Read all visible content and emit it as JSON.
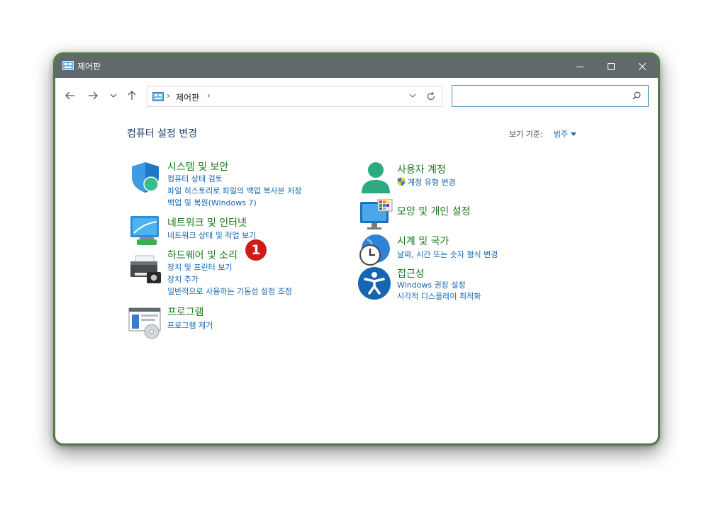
{
  "window": {
    "title": "제어판"
  },
  "address": {
    "crumb": "제어판",
    "separator": "›"
  },
  "search": {
    "placeholder": ""
  },
  "page": {
    "title": "컴퓨터 설정 변경"
  },
  "view_by": {
    "label": "보기 기준:",
    "value": "범주"
  },
  "left_categories": [
    {
      "title": "시스템 및 보안",
      "icon": "shield-icon",
      "links": [
        "컴퓨터 상태 검토",
        "파일 히스토리로 파일의 백업 복사본 저장",
        "백업 및 복원(Windows 7)"
      ]
    },
    {
      "title": "네트워크 및 인터넷",
      "icon": "network-icon",
      "links": [
        "네트워크 상태 및 작업 보기"
      ]
    },
    {
      "title": "하드웨어 및 소리",
      "icon": "printer-icon",
      "links": [
        "장치 및 프린터 보기",
        "장치 추가",
        "일반적으로 사용하는 기동성 설정 조정"
      ]
    },
    {
      "title": "프로그램",
      "icon": "programs-icon",
      "links": [
        "프로그램 제거"
      ]
    }
  ],
  "right_categories": [
    {
      "title": "사용자 계정",
      "icon": "user-icon",
      "links": [
        "계정 유형 변경"
      ]
    },
    {
      "title": "모양 및 개인 설정",
      "icon": "monitor-icon",
      "links": []
    },
    {
      "title": "시계 및 국가",
      "icon": "clock-globe-icon",
      "links": [
        "날짜, 시간 또는 숫자 형식 변경"
      ]
    },
    {
      "title": "접근성",
      "icon": "accessibility-icon",
      "links": [
        "Windows 권장 설정",
        "시각적 디스플레이 최적화"
      ]
    }
  ],
  "badge": {
    "number": "1"
  },
  "colors": {
    "title_bar": "#60696c",
    "category_title": "#1a7a1a",
    "link": "#1566b0",
    "frame": "#4f7a43",
    "badge": "#d11a1a"
  }
}
